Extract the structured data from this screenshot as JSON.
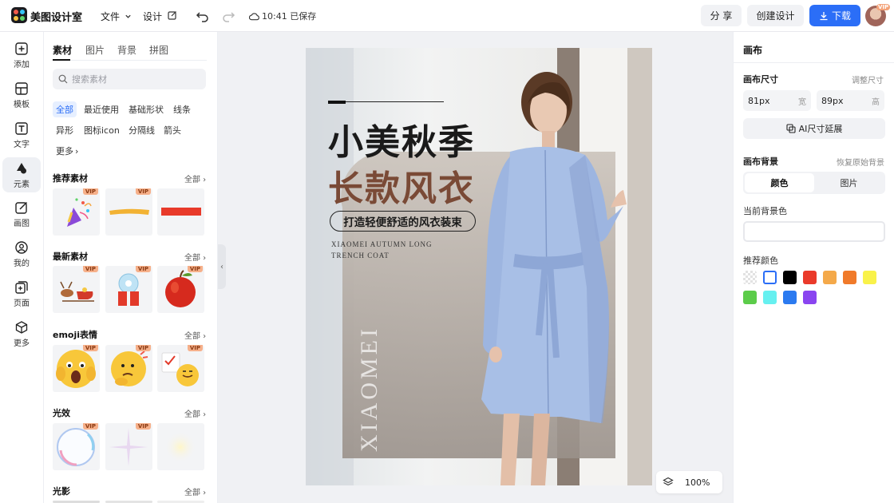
{
  "app": {
    "name": "美图设计室"
  },
  "header": {
    "menu_file": "文件",
    "menu_design": "设计",
    "saved_status": "10:41 已保存",
    "share_label": "分 享",
    "create_label": "创建设计",
    "download_label": "下载",
    "avatar_badge": "VIP"
  },
  "left_nav": {
    "items": [
      {
        "label": "添加",
        "icon": "plus-square-icon"
      },
      {
        "label": "模板",
        "icon": "template-icon"
      },
      {
        "label": "文字",
        "icon": "text-icon"
      },
      {
        "label": "元素",
        "icon": "shapes-icon"
      },
      {
        "label": "画图",
        "icon": "pencil-square-icon"
      },
      {
        "label": "我的",
        "icon": "user-icon"
      },
      {
        "label": "页面",
        "icon": "pages-icon"
      },
      {
        "label": "更多",
        "icon": "cube-icon"
      }
    ],
    "active_index": 3
  },
  "assets": {
    "tabs": [
      "素材",
      "图片",
      "背景",
      "拼图"
    ],
    "search_placeholder": "搜索素材",
    "chips": [
      "全部",
      "最近使用",
      "基础形状",
      "线条",
      "异形",
      "图标icon",
      "分隔线",
      "箭头",
      "更多"
    ],
    "all_label": "全部",
    "vip_label": "VIP",
    "sections": [
      {
        "title": "推荐素材"
      },
      {
        "title": "最新素材"
      },
      {
        "title": "emoji表情"
      },
      {
        "title": "光效"
      },
      {
        "title": "光影"
      }
    ]
  },
  "poster": {
    "line1": "小美秋季",
    "line2": "长款风衣",
    "subtitle": "打造轻便舒适的风衣装束",
    "en_line1": "XIAOMEI AUTUMN LONG",
    "en_line2": "TRENCH COAT",
    "vertical_text": "XIAOMEI"
  },
  "zoom": {
    "value": "100%"
  },
  "right_panel": {
    "title": "画布",
    "size_label": "画布尺寸",
    "adjust_size": "调整尺寸",
    "width_value": "81px",
    "width_unit": "宽",
    "height_value": "89px",
    "height_unit": "高",
    "ai_extend": "AI尺寸延展",
    "bg_label": "画布背景",
    "restore_bg": "恢复原始背景",
    "seg_color": "颜色",
    "seg_image": "图片",
    "current_bg_label": "当前背景色",
    "recommended_label": "推荐颜色",
    "swatches": [
      "transparent",
      "#ffffff",
      "#000000",
      "#ea3a2a",
      "#f4a94a",
      "#f07a2a",
      "#f9f24a",
      "#5ccc4a",
      "#66f0f0",
      "#2b7af0",
      "#8a45f0"
    ]
  },
  "colors": {
    "accent": "#2b6ef7",
    "poster_brown": "#7a4a36"
  }
}
